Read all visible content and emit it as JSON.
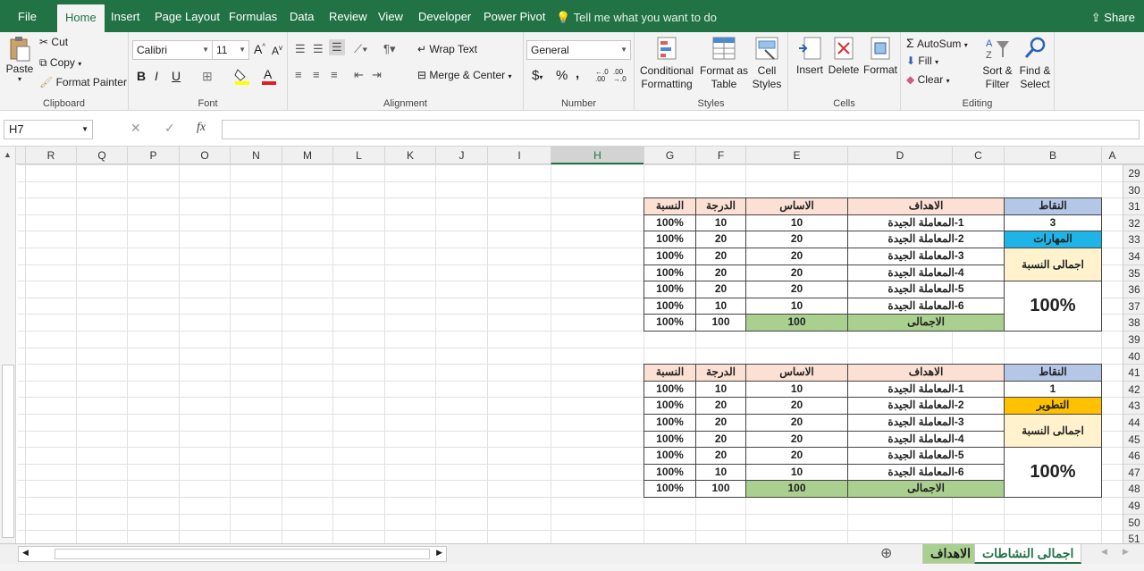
{
  "menu": {
    "file": "File",
    "home": "Home",
    "insert": "Insert",
    "page_layout": "Page Layout",
    "formulas": "Formulas",
    "data": "Data",
    "review": "Review",
    "view": "View",
    "developer": "Developer",
    "power_pivot": "Power Pivot",
    "tell_me": "Tell me what you want to do",
    "share": "Share"
  },
  "ribbon": {
    "paste": "Paste",
    "cut": "Cut",
    "copy": "Copy",
    "format_painter": "Format Painter",
    "clipboard": "Clipboard",
    "font_name": "Calibri",
    "font_size": "11",
    "font": "Font",
    "wrap_text": "Wrap Text",
    "merge_center": "Merge & Center",
    "alignment": "Alignment",
    "number_format": "General",
    "number": "Number",
    "conditional_formatting": "Conditional Formatting",
    "format_as_table": "Format as Table",
    "cell_styles": "Cell Styles",
    "styles": "Styles",
    "insert": "Insert",
    "delete": "Delete",
    "format": "Format",
    "cells": "Cells",
    "autosum": "AutoSum",
    "fill": "Fill",
    "clear": "Clear",
    "sort_filter": "Sort & Filter",
    "find_select": "Find & Select",
    "editing": "Editing",
    "bold": "B",
    "italic": "I",
    "underline": "U",
    "currency": "$",
    "percent": "%",
    "comma": ","
  },
  "formula_bar": {
    "name_box": "H7",
    "fx": "fx",
    "value": ""
  },
  "columns": [
    "A",
    "B",
    "C",
    "D",
    "E",
    "F",
    "G",
    "H",
    "I",
    "J",
    "K",
    "L",
    "M",
    "N",
    "O",
    "P",
    "Q",
    "R"
  ],
  "rows": [
    "29",
    "30",
    "31",
    "32",
    "33",
    "34",
    "35",
    "36",
    "37",
    "38",
    "39",
    "40",
    "41",
    "42",
    "43",
    "44",
    "45",
    "46",
    "47",
    "48",
    "49",
    "50",
    "51"
  ],
  "table1": {
    "header": {
      "points": "النقاط",
      "goals": "الاهداف",
      "basis": "الاساس",
      "grade": "الدرجة",
      "ratio": "النسبة"
    },
    "points_value": "3",
    "category": "المهارات",
    "total_ratio_label": "اجمالى النسبة",
    "total_ratio_value": "100%",
    "rows": [
      {
        "goal": "1-المعاملة الجيدة",
        "basis": "10",
        "grade": "10",
        "ratio": "100%"
      },
      {
        "goal": "2-المعاملة الجيدة",
        "basis": "20",
        "grade": "20",
        "ratio": "100%"
      },
      {
        "goal": "3-المعاملة الجيدة",
        "basis": "20",
        "grade": "20",
        "ratio": "100%"
      },
      {
        "goal": "4-المعاملة الجيدة",
        "basis": "20",
        "grade": "20",
        "ratio": "100%"
      },
      {
        "goal": "5-المعاملة الجيدة",
        "basis": "20",
        "grade": "20",
        "ratio": "100%"
      },
      {
        "goal": "6-المعاملة الجيدة",
        "basis": "10",
        "grade": "10",
        "ratio": "100%"
      }
    ],
    "total": {
      "label": "الاجمالى",
      "basis": "100",
      "grade": "100",
      "ratio": "100%"
    }
  },
  "table2": {
    "header": {
      "points": "النقاط",
      "goals": "الاهداف",
      "basis": "الاساس",
      "grade": "الدرجة",
      "ratio": "النسبة"
    },
    "points_value": "1",
    "category": "التطوير",
    "total_ratio_label": "اجمالى النسبة",
    "total_ratio_value": "100%",
    "rows": [
      {
        "goal": "1-المعاملة الجيدة",
        "basis": "10",
        "grade": "10",
        "ratio": "100%"
      },
      {
        "goal": "2-المعاملة الجيدة",
        "basis": "20",
        "grade": "20",
        "ratio": "100%"
      },
      {
        "goal": "3-المعاملة الجيدة",
        "basis": "20",
        "grade": "20",
        "ratio": "100%"
      },
      {
        "goal": "4-المعاملة الجيدة",
        "basis": "20",
        "grade": "20",
        "ratio": "100%"
      },
      {
        "goal": "5-المعاملة الجيدة",
        "basis": "20",
        "grade": "20",
        "ratio": "100%"
      },
      {
        "goal": "6-المعاملة الجيدة",
        "basis": "10",
        "grade": "10",
        "ratio": "100%"
      }
    ],
    "total": {
      "label": "الاجمالى",
      "basis": "100",
      "grade": "100",
      "ratio": "100%"
    }
  },
  "sheets": {
    "tab1": "اجمالى النشاطات",
    "tab2": "الاهداف"
  },
  "colors": {
    "excel_green": "#217346",
    "header_blue": "#b4c7e7",
    "header_peach": "#fbe0d3",
    "skills_cyan": "#1fb4e8",
    "dev_orange": "#ffc000",
    "total_yellow": "#fff2cc",
    "total_green": "#a9d08e"
  }
}
